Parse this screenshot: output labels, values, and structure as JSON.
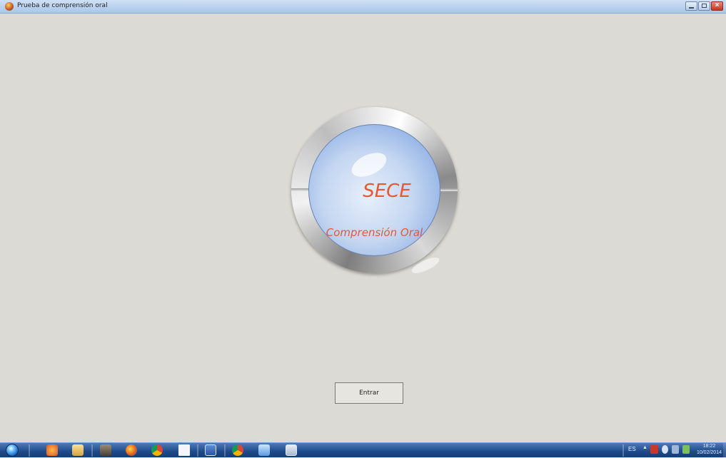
{
  "window": {
    "title": "Prueba de comprensión oral"
  },
  "logo": {
    "title": "SECE",
    "subtitle": "Comprensión Oral"
  },
  "main": {
    "enter_label": "Entrar"
  },
  "taskbar": {
    "language": "ES",
    "time": "18:22",
    "date": "10/02/2014",
    "pinned_icons": [
      "media-player-icon",
      "folder-icon",
      "gimp-icon",
      "firefox-icon",
      "chrome-icon",
      "document-icon",
      "word-icon",
      "chrome-icon",
      "photo-viewer-icon",
      "app-window-icon"
    ]
  },
  "colors": {
    "logo_text": "#e25a33",
    "background": "#dcdad4",
    "taskbar": "#1f4a8a"
  }
}
